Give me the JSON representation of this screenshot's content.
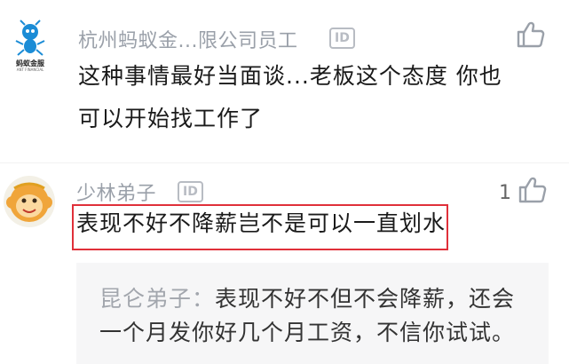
{
  "comments": [
    {
      "username": "杭州蚂蚁金...限公司员工",
      "badge": "ID",
      "avatar_text": "蚂蚁金服",
      "avatar_subtext": "ANT FINANCIAL",
      "lines": [
        "这种事情最好当面谈...老板这个态度 你也",
        "可以开始找工作了"
      ],
      "likes": ""
    },
    {
      "username": "少林弟子",
      "badge": "ID",
      "lines": [
        "表现不好不降薪岂不是可以一直划水"
      ],
      "likes": "1"
    }
  ],
  "reply": {
    "author": "昆仑弟子：",
    "line1": "表现不好不但不会降薪，还会",
    "line2": "一个月发你好几个月工资，不信你试试。"
  },
  "colors": {
    "highlight": "#e0303a",
    "username": "#9aa0a9",
    "text": "#1a1a1a",
    "reply_bg": "#f6f6f7"
  },
  "icons": [
    "ant-logo-avatar",
    "monkey-avatar",
    "thumbs-up-icon",
    "id-badge-icon"
  ]
}
